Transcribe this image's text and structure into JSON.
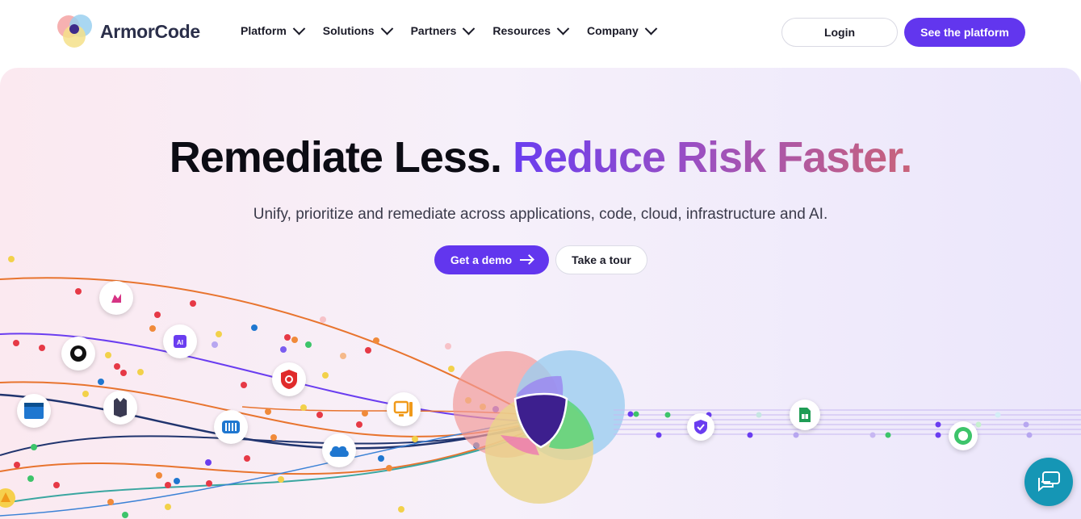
{
  "brand": {
    "name": "ArmorCode",
    "accent": "#6236ee"
  },
  "nav": {
    "items": [
      {
        "label": "Platform"
      },
      {
        "label": "Solutions"
      },
      {
        "label": "Partners"
      },
      {
        "label": "Resources"
      },
      {
        "label": "Company"
      }
    ]
  },
  "header": {
    "login_label": "Login",
    "cta_label": "See the platform"
  },
  "hero": {
    "title_plain": "Remediate Less.",
    "title_gradient": "Reduce Risk Faster.",
    "subtitle": "Unify, prioritize and remediate across applications, code, cloud, infrastructure and AI.",
    "demo_label": "Get a demo",
    "tour_label": "Take a tour"
  },
  "integrations": [
    "app-icon",
    "github-icon",
    "ai-chip-icon",
    "jenkins-icon",
    "qualys-icon",
    "kubernetes-icon",
    "cloud-icon",
    "server-icon",
    "shield-icon",
    "sheet-icon",
    "user-icon",
    "warning-icon"
  ],
  "chat": {
    "icon": "chat-icon"
  }
}
